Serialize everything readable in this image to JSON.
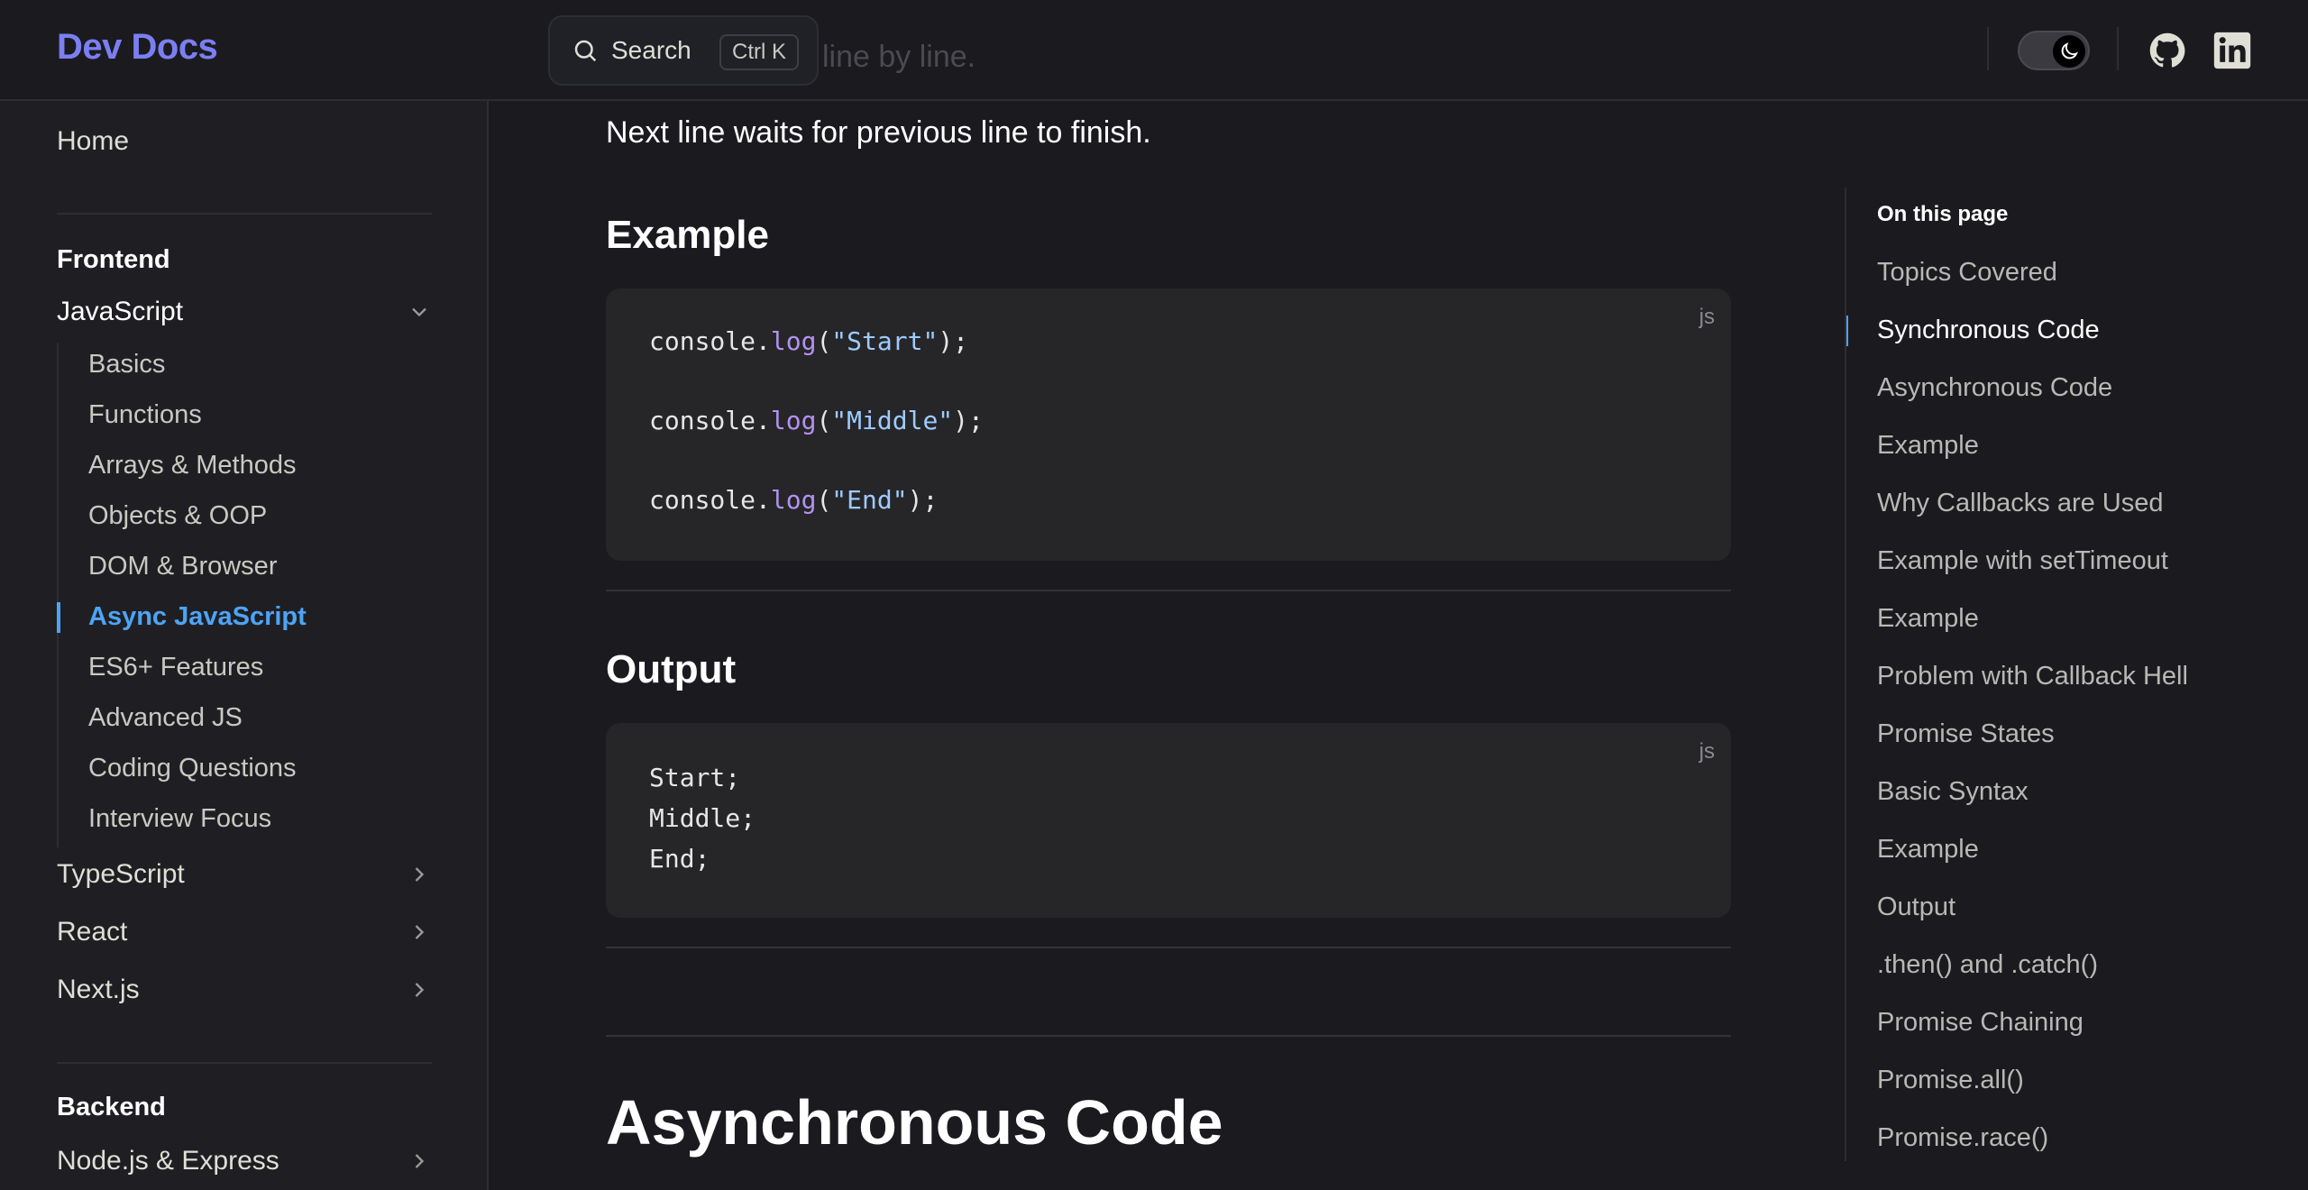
{
  "header": {
    "brand": "Dev Docs",
    "search_label": "Search",
    "search_shortcut": "Ctrl K",
    "ghost_text": "line by line."
  },
  "sidebar": {
    "home": "Home",
    "frontend_section": "Frontend",
    "javascript": "JavaScript",
    "js_items": [
      "Basics",
      "Functions",
      "Arrays & Methods",
      "Objects & OOP",
      "DOM & Browser",
      "Async JavaScript",
      "ES6+ Features",
      "Advanced JS",
      "Coding Questions",
      "Interview Focus"
    ],
    "typescript": "TypeScript",
    "react": "React",
    "nextjs": "Next.js",
    "backend_section": "Backend",
    "node_express": "Node.js & Express"
  },
  "main": {
    "intro": "Next line waits for previous line to finish.",
    "example_heading": "Example",
    "output_heading": "Output",
    "code_lang": "js",
    "output_lang": "js",
    "code_lines": [
      {
        "obj": "console.",
        "fn": "log",
        "open": "(",
        "str": "\"Start\"",
        "close": ");"
      },
      {
        "obj": "console.",
        "fn": "log",
        "open": "(",
        "str": "\"Middle\"",
        "close": ");"
      },
      {
        "obj": "console.",
        "fn": "log",
        "open": "(",
        "str": "\"End\"",
        "close": ");"
      }
    ],
    "output_lines": [
      "Start;",
      "Middle;",
      "End;"
    ],
    "async_heading": "Asynchronous Code"
  },
  "toc": {
    "title": "On this page",
    "items": [
      "Topics Covered",
      "Synchronous Code",
      "Asynchronous Code",
      "Example",
      "Why Callbacks are Used",
      "Example with setTimeout",
      "Example",
      "Problem with Callback Hell",
      "Promise States",
      "Basic Syntax",
      "Example",
      "Output",
      ".then() and .catch()",
      "Promise Chaining",
      "Promise.all()",
      "Promise.race()"
    ],
    "active_index": 1
  },
  "colors": {
    "accent": "#4ea3f5",
    "brand": "#7b7ff2",
    "background": "#1b1b1f"
  }
}
